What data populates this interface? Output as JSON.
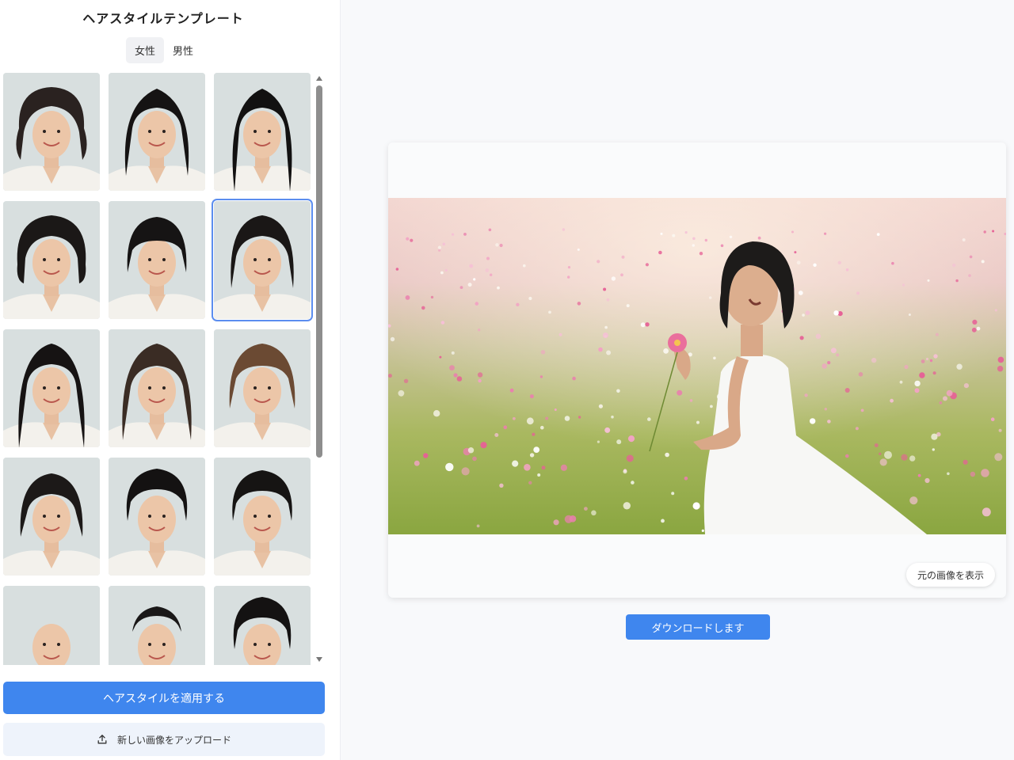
{
  "panel": {
    "title": "ヘアスタイルテンプレート",
    "tabs": [
      {
        "label": "女性",
        "active": true
      },
      {
        "label": "男性",
        "active": false
      }
    ],
    "apply_label": "ヘアスタイルを適用する",
    "upload_label": "新しい画像をアップロード",
    "selected_index": 5
  },
  "preview": {
    "view_original_label": "元の画像を表示",
    "download_label": "ダウンロードします"
  },
  "colors": {
    "accent": "#3f86ee",
    "selected_outline": "#5b8def"
  }
}
